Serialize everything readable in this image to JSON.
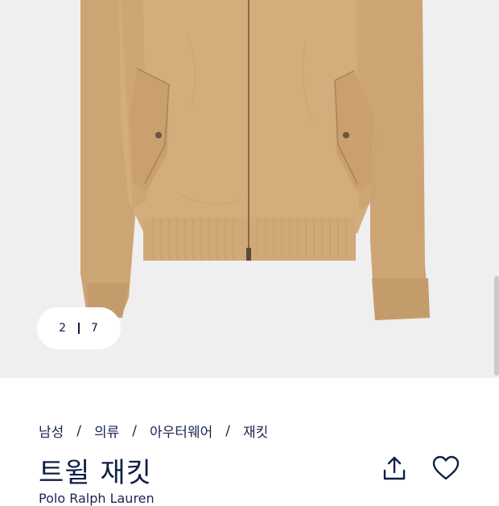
{
  "gallery": {
    "current_index": "2",
    "total_images": "7",
    "image_subject": "beige twill zip-up jacket with flap pockets and ribbed hem"
  },
  "breadcrumb": [
    "남성",
    "의류",
    "아우터웨어",
    "재킷"
  ],
  "product": {
    "title": "트윌 재킷",
    "brand": "Polo Ralph Lauren"
  },
  "actions": {
    "share_icon": "share-icon",
    "wishlist_icon": "heart-icon"
  },
  "colors": {
    "navy": "#0f1e46",
    "jacket": "#d4ad7d",
    "background": "#efefef"
  }
}
